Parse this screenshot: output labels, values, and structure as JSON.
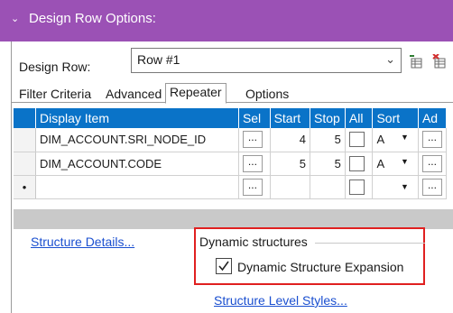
{
  "header": {
    "title": "Design Row Options:"
  },
  "design_row": {
    "label": "Design Row:",
    "value": "Row #1"
  },
  "tabs": [
    {
      "label": "Filter Criteria"
    },
    {
      "label": "Advanced"
    },
    {
      "label": "Repeater"
    },
    {
      "label": "Options"
    }
  ],
  "grid": {
    "headers": [
      "Display Item",
      "Sel",
      "Start",
      "Stop",
      "All",
      "Sort",
      "Ad"
    ],
    "rows": [
      {
        "item": "DIM_ACCOUNT.SRI_NODE_ID",
        "sel": "...",
        "start": "4",
        "stop": "5",
        "sort": "A",
        "add": "..."
      },
      {
        "item": "DIM_ACCOUNT.CODE",
        "sel": "...",
        "start": "5",
        "stop": "5",
        "sort": "A",
        "add": "..."
      },
      {
        "item": "",
        "sel": "...",
        "start": "",
        "stop": "",
        "sort": "",
        "add": "...",
        "marker": "•"
      }
    ]
  },
  "links": {
    "structure_details": "Structure Details...",
    "structure_level_styles": "Structure Level Styles..."
  },
  "dynamic": {
    "group_label": "Dynamic structures",
    "expansion_label": "Dynamic Structure Expansion",
    "expansion_checked": true
  },
  "colors": {
    "header_bar": "#9b51b5",
    "grid_header": "#0a73c8",
    "highlight": "#e02020",
    "link": "#1a4fd0"
  }
}
